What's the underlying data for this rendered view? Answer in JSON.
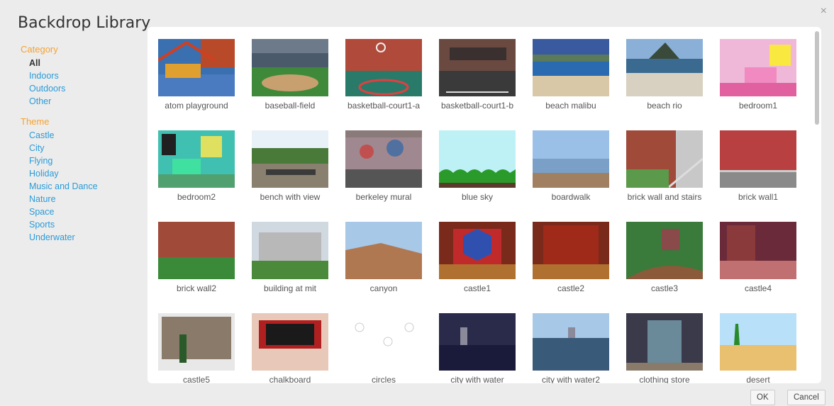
{
  "dialog": {
    "title": "Backdrop Library",
    "close_glyph": "×",
    "ok_label": "OK",
    "cancel_label": "Cancel"
  },
  "sidebar": {
    "category_title": "Category",
    "categories": [
      "All",
      "Indoors",
      "Outdoors",
      "Other"
    ],
    "active_category": "All",
    "theme_title": "Theme",
    "themes": [
      "Castle",
      "City",
      "Flying",
      "Holiday",
      "Music and Dance",
      "Nature",
      "Space",
      "Sports",
      "Underwater"
    ]
  },
  "backdrops": [
    "atom playground",
    "baseball-field",
    "basketball-court1-a",
    "basketball-court1-b",
    "beach malibu",
    "beach rio",
    "bedroom1",
    "bedroom2",
    "bench with view",
    "berkeley mural",
    "blue sky",
    "boardwalk",
    "brick wall and stairs",
    "brick wall1",
    "brick wall2",
    "building at mit",
    "canyon",
    "castle1",
    "castle2",
    "castle3",
    "castle4",
    "castle5",
    "chalkboard",
    "circles",
    "city with water",
    "city with water2",
    "clothing store",
    "desert"
  ],
  "colors": {
    "section_heading": "#f7a230",
    "link": "#2a9bd8",
    "panel": "#ffffff",
    "background": "#ececec"
  }
}
